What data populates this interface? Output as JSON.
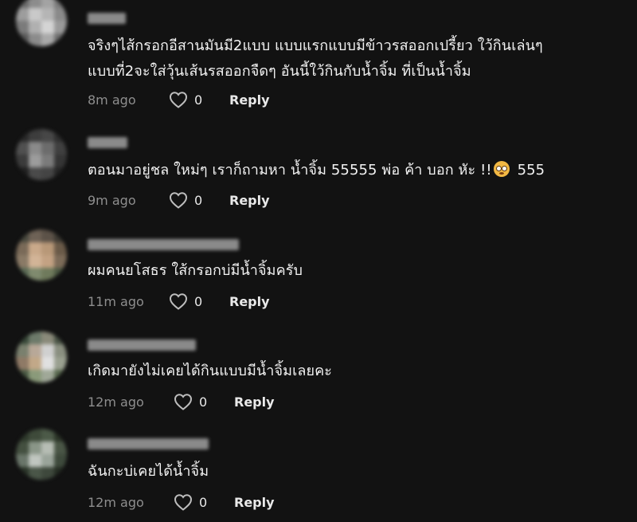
{
  "comments": [
    {
      "text_line1": "จริงๆไส้กรอกอีสานมันมี2แบบ แบบแรกแบบมีข้าวรสออกเปรี้ยว ใว้กินเล่นๆ",
      "text_line2": "แบบที่2จะใส่วุ้นเส้นรสออกจืดๆ อันนี้ใว้กินกับน้ำจิ้ม ที่เป็นน้ำจิ้ม",
      "time": "8m ago",
      "likes": "0",
      "reply": "Reply"
    },
    {
      "text_before_emoji": "ตอนมาอยู่ชล ใหม่ๆ เราก็ถามหา น้ำจิ้ม 55555 พ่อ ค้า บอก หัะ !!",
      "emoji": "flushed-face-emoji",
      "text_after_emoji": "555",
      "time": "9m ago",
      "likes": "0",
      "reply": "Reply"
    },
    {
      "text": "ผมคนยโสธร ใส้กรอกบ่มีน้ำจิ้มครับ",
      "time": "11m ago",
      "likes": "0",
      "reply": "Reply"
    },
    {
      "text": "เกิดมายังไม่เคยได้กินแบบมีน้ำจิ้มเลยคะ",
      "time": "12m ago",
      "likes": "0",
      "reply": "Reply"
    },
    {
      "text": "ฉันกะบ่เคยได้น้ำจิ้ม",
      "time": "12m ago",
      "likes": "0",
      "reply": "Reply"
    }
  ],
  "icons": {
    "like": "heart-outline-icon",
    "emoji": "flushed-face-emoji"
  },
  "colors": {
    "background": "#121212",
    "text": "#f2f2f2",
    "time": "#8e8e8e",
    "reply": "#e9e9e9"
  }
}
